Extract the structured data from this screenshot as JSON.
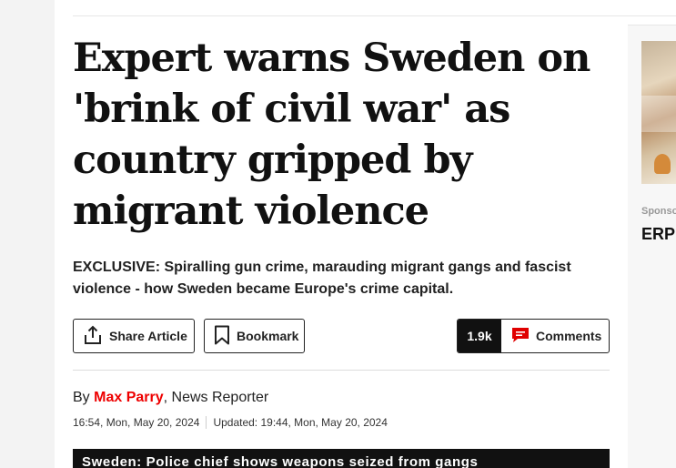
{
  "article": {
    "headline": "Expert warns Sweden on 'brink of civil war' as country gripped by migrant violence",
    "standfirst": "EXCLUSIVE: Spiralling gun crime, marauding migrant gangs and fascist violence - how Sweden became Europe's crime capital.",
    "byline_prefix": "By ",
    "author": "Max Parry",
    "author_role": ", News Reporter",
    "published": "16:54, Mon, May 20, 2024",
    "updated": "Updated: 19:44, Mon, May 20, 2024"
  },
  "actions": {
    "share_label": "Share Article",
    "bookmark_label": "Bookmark",
    "comment_count": "1.9k",
    "comments_label": "Comments"
  },
  "video": {
    "title": "Sweden: Police chief shows weapons seized from gangs"
  },
  "sidebar": {
    "sponsored_label": "Sponsored",
    "ad_title": "ERP"
  },
  "colors": {
    "author": "#e00000",
    "comment_icon": "#e00000",
    "video_bar": "#111111"
  }
}
